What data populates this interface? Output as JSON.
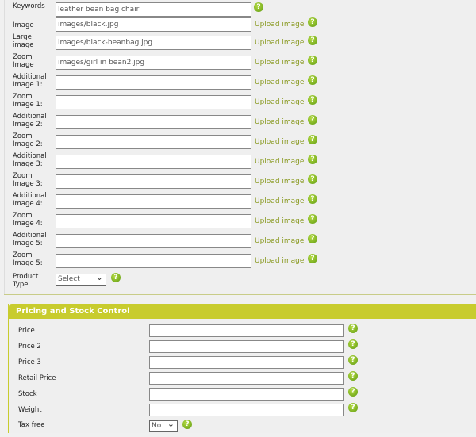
{
  "image_fields": [
    {
      "label": "Keywords",
      "value": "leather bean bag chair",
      "upload": false
    },
    {
      "label": "Image",
      "value": "images/black.jpg",
      "upload": true
    },
    {
      "label": "Large image",
      "value": "images/black-beanbag.jpg",
      "upload": true
    },
    {
      "label": "Zoom Image",
      "value": "images/girl in bean2.jpg",
      "upload": true
    },
    {
      "label": "Additional Image 1:",
      "value": "",
      "upload": true
    },
    {
      "label": "Zoom Image 1:",
      "value": "",
      "upload": true
    },
    {
      "label": "Additional Image 2:",
      "value": "",
      "upload": true
    },
    {
      "label": "Zoom Image 2:",
      "value": "",
      "upload": true
    },
    {
      "label": "Additional Image 3:",
      "value": "",
      "upload": true
    },
    {
      "label": "Zoom Image 3:",
      "value": "",
      "upload": true
    },
    {
      "label": "Additional Image 4:",
      "value": "",
      "upload": true
    },
    {
      "label": "Zoom Image 4:",
      "value": "",
      "upload": true
    },
    {
      "label": "Additional Image 5:",
      "value": "",
      "upload": true
    },
    {
      "label": "Zoom Image 5:",
      "value": "",
      "upload": true
    }
  ],
  "upload_label": "Upload image",
  "help_glyph": "?",
  "product_type": {
    "label": "Product Type",
    "selected": "Select"
  },
  "pricing": {
    "title": "Pricing and Stock Control",
    "fields": [
      "Price",
      "Price 2",
      "Price 3",
      "Retail Price",
      "Stock",
      "Weight"
    ],
    "tax_free": {
      "label": "Tax free",
      "selected": "No"
    }
  },
  "colors": {
    "accent": "#c8cc2e",
    "link": "#8a9a22",
    "help": "#6aa814"
  }
}
